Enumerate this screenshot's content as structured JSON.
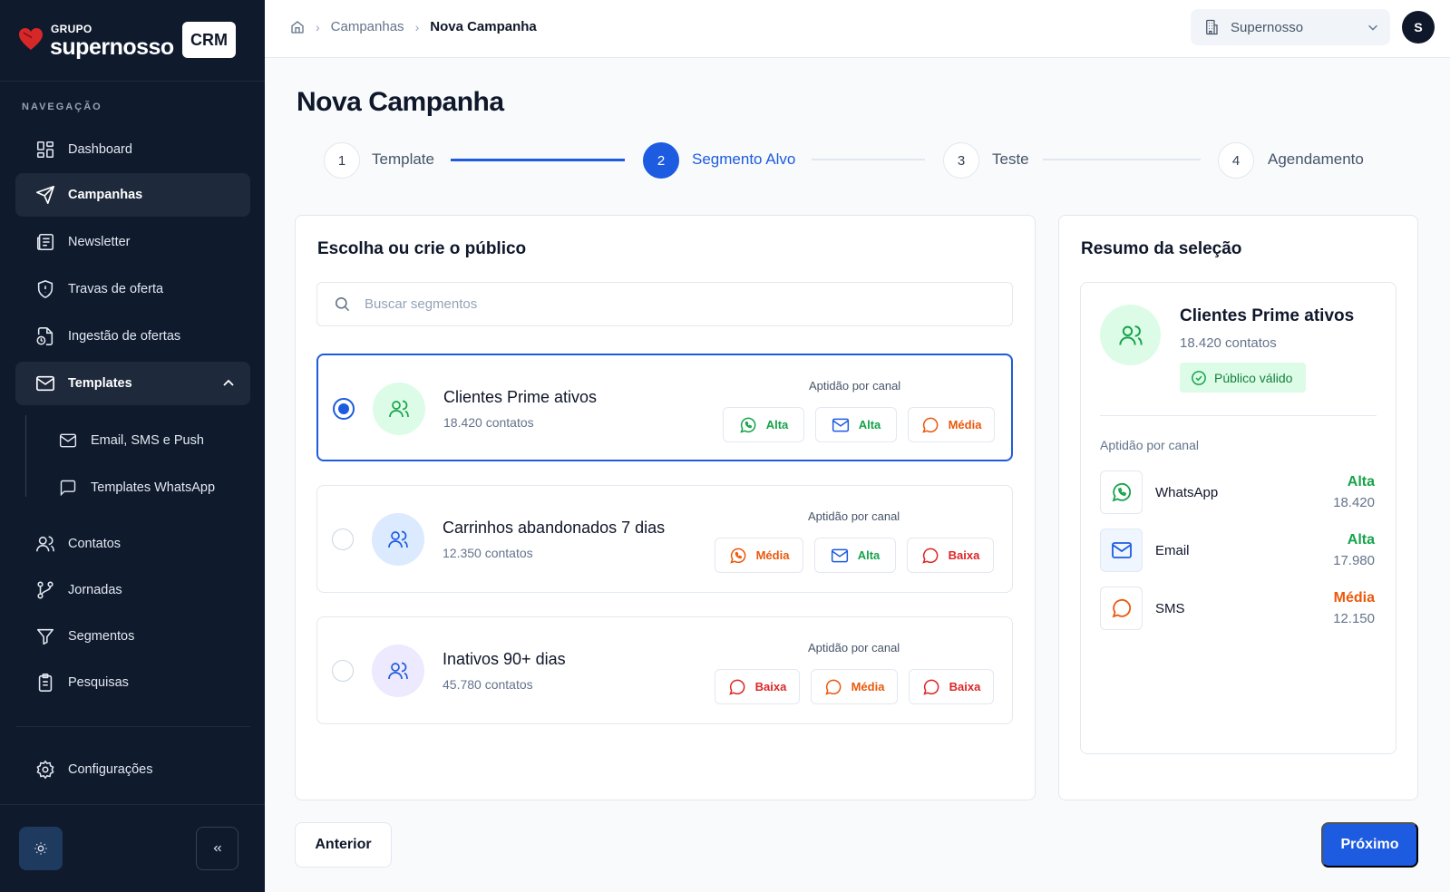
{
  "brand": {
    "group": "GRUPO",
    "name": "supernosso",
    "badge": "CRM"
  },
  "sidebar": {
    "heading": "NAVEGAÇÃO",
    "items": [
      {
        "label": "Dashboard",
        "icon": "grid-icon"
      },
      {
        "label": "Campanhas",
        "icon": "send-icon",
        "active": true
      },
      {
        "label": "Newsletter",
        "icon": "newspaper-icon"
      },
      {
        "label": "Travas de oferta",
        "icon": "shield-icon"
      },
      {
        "label": "Ingestão de ofertas",
        "icon": "file-sync-icon"
      },
      {
        "label": "Templates",
        "icon": "mail-icon",
        "expanded": true
      }
    ],
    "sub_items": [
      {
        "label": "Email, SMS e Push",
        "icon": "mail-icon"
      },
      {
        "label": "Templates WhatsApp",
        "icon": "chat-icon"
      }
    ],
    "items2": [
      {
        "label": "Contatos",
        "icon": "users-icon"
      },
      {
        "label": "Jornadas",
        "icon": "branch-icon"
      },
      {
        "label": "Segmentos",
        "icon": "filter-icon"
      },
      {
        "label": "Pesquisas",
        "icon": "clipboard-icon"
      }
    ],
    "settings": "Configurações"
  },
  "topbar": {
    "breadcrumb": [
      "Campanhas",
      "Nova Campanha"
    ],
    "org": "Supernosso",
    "avatar": "S"
  },
  "page_title": "Nova Campanha",
  "stepper": [
    {
      "num": "1",
      "label": "Template",
      "state": "done"
    },
    {
      "num": "2",
      "label": "Segmento Alvo",
      "state": "active"
    },
    {
      "num": "3",
      "label": "Teste",
      "state": "pending"
    },
    {
      "num": "4",
      "label": "Agendamento",
      "state": "pending"
    }
  ],
  "left_card": {
    "title": "Escolha ou crie o público",
    "search_placeholder": "Buscar segmentos",
    "aptitude_label": "Aptidão por canal",
    "segments": [
      {
        "name": "Clientes Prime ativos",
        "count": "18.420 contatos",
        "selected": true,
        "chips": [
          {
            "channel": "whatsapp",
            "level": "Alta"
          },
          {
            "channel": "email",
            "level": "Alta"
          },
          {
            "channel": "sms",
            "level": "Média"
          }
        ]
      },
      {
        "name": "Carrinhos abandonados 7 dias",
        "count": "12.350 contatos",
        "selected": false,
        "chips": [
          {
            "channel": "whatsapp",
            "level": "Média"
          },
          {
            "channel": "email",
            "level": "Alta"
          },
          {
            "channel": "sms",
            "level": "Baixa"
          }
        ]
      },
      {
        "name": "Inativos 90+ dias",
        "count": "45.780 contatos",
        "selected": false,
        "chips": [
          {
            "channel": "whatsapp",
            "level": "Baixa"
          },
          {
            "channel": "sms",
            "level": "Média"
          },
          {
            "channel": "sms",
            "level": "Baixa"
          }
        ]
      }
    ]
  },
  "summary": {
    "title": "Resumo da seleção",
    "segment_name": "Clientes Prime ativos",
    "segment_count": "18.420 contatos",
    "status": "Público válido",
    "aptitude_label": "Aptidão por canal",
    "channels": [
      {
        "name": "WhatsApp",
        "level": "Alta",
        "value": "18.420"
      },
      {
        "name": "Email",
        "level": "Alta",
        "value": "17.980"
      },
      {
        "name": "SMS",
        "level": "Média",
        "value": "12.150"
      }
    ]
  },
  "footer": {
    "prev": "Anterior",
    "next": "Próximo"
  },
  "colors": {
    "primary": "#1d5be0",
    "sidebar": "#0f1a2d",
    "alta": "#16a34a",
    "media": "#ea580c",
    "baixa": "#dc2626"
  }
}
